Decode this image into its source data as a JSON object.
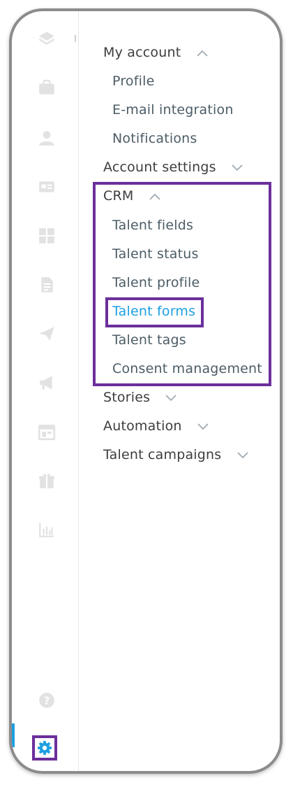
{
  "sidebar": {
    "icons": [
      "layers-icon",
      "briefcase-icon",
      "user-icon",
      "id-card-icon",
      "dashboard-grid-icon",
      "document-icon",
      "send-icon",
      "megaphone-icon",
      "calendar-icon",
      "gift-icon",
      "bar-chart-icon",
      "help-icon",
      "settings-icon"
    ],
    "active": "settings-icon",
    "colors": {
      "icon": "#e2e2e2",
      "active": "#1c9fe0",
      "highlight": "#6b2f9b"
    }
  },
  "menu": {
    "my_account": {
      "label": "My account",
      "expanded": true
    },
    "profile": "Profile",
    "email_integration": "E-mail integration",
    "notifications": "Notifications",
    "account_settings": {
      "label": "Account settings",
      "expanded": false
    },
    "crm": {
      "label": "CRM",
      "expanded": true
    },
    "talent_fields": "Talent fields",
    "talent_status": "Talent status",
    "talent_profile": "Talent profile",
    "talent_forms": "Talent forms",
    "talent_tags": "Talent tags",
    "consent_management": "Consent management",
    "stories": {
      "label": "Stories",
      "expanded": false
    },
    "automation": {
      "label": "Automation",
      "expanded": false
    },
    "talent_campaigns": {
      "label": "Talent campaigns",
      "expanded": false
    },
    "selected": "Talent forms"
  }
}
